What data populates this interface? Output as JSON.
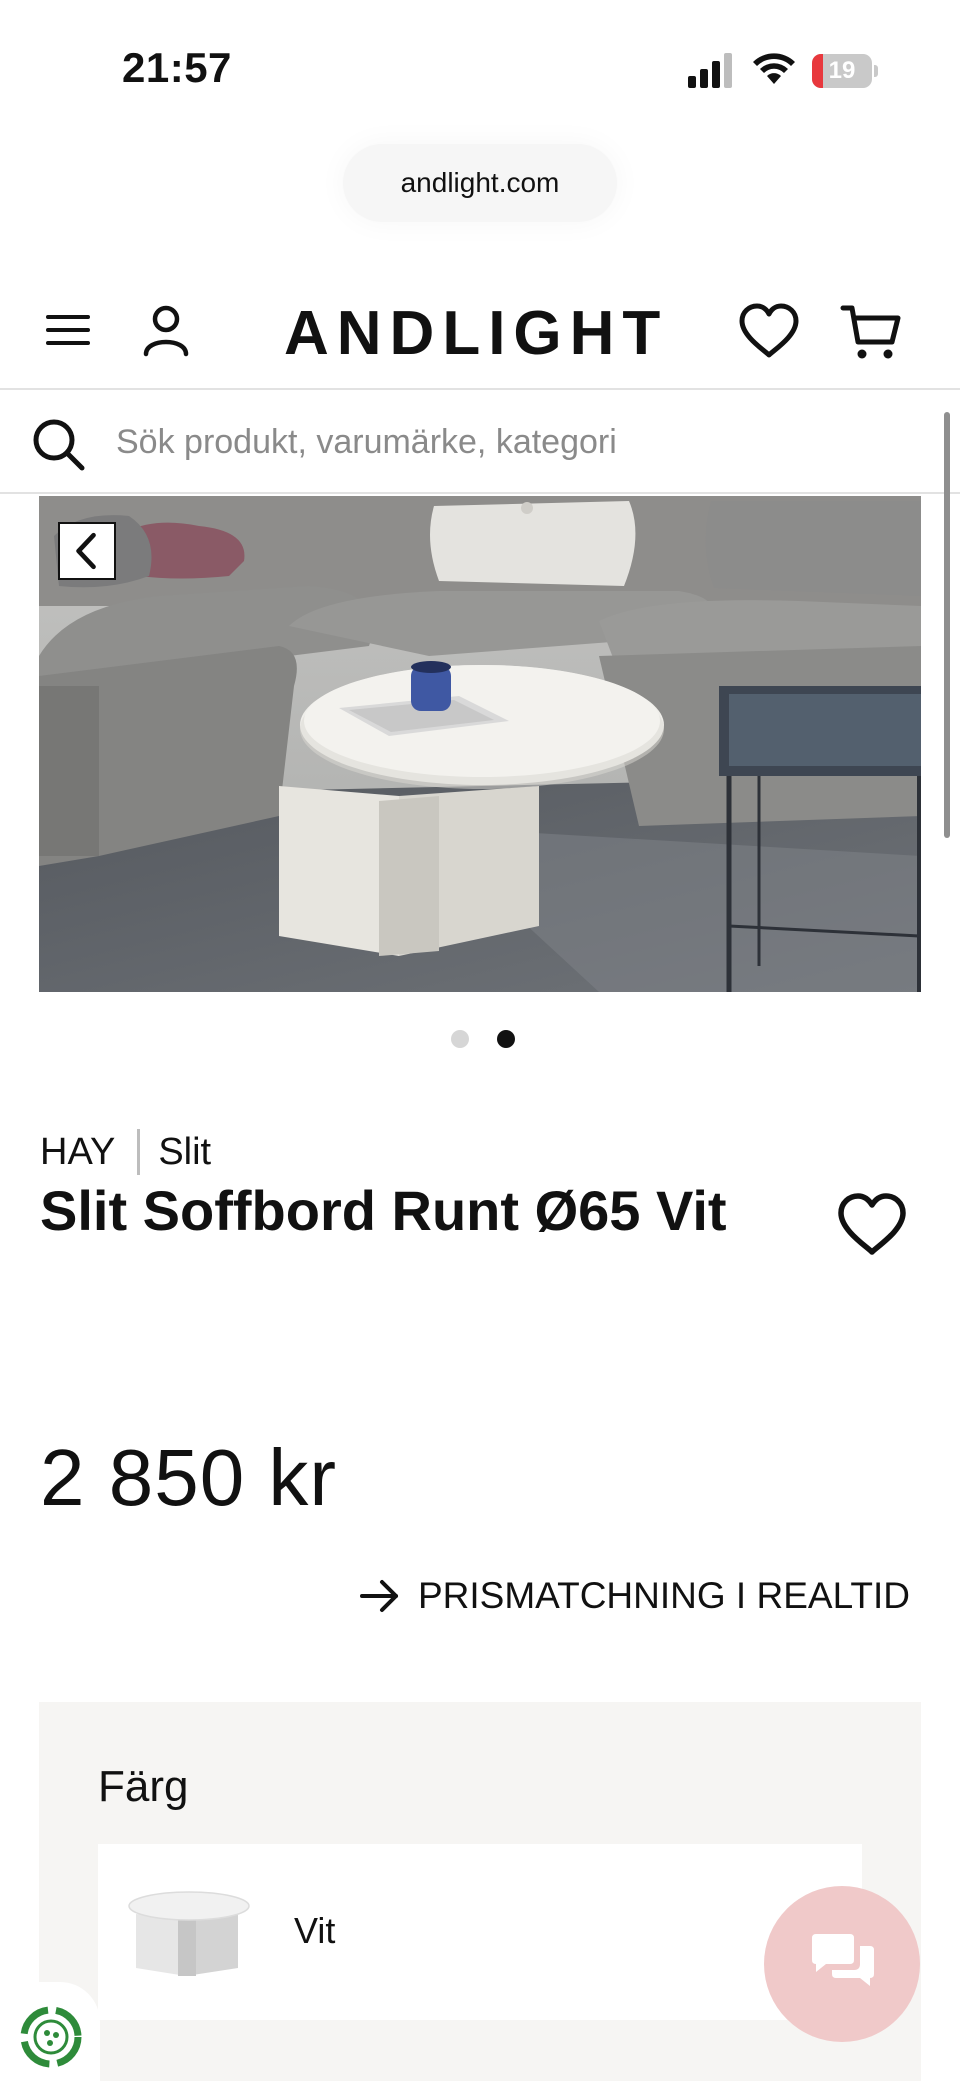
{
  "status_bar": {
    "time": "21:57",
    "battery_level": "19",
    "battery_fraction": 0.19,
    "battery_color": "#e8383d"
  },
  "browser": {
    "url": "andlight.com"
  },
  "header": {
    "logo": "ANDLIGHT",
    "icons": [
      "menu-icon",
      "account-icon",
      "wishlist-icon",
      "cart-icon"
    ]
  },
  "search": {
    "placeholder": "Sök produkt, varumärke, kategori"
  },
  "gallery": {
    "image_count": 2,
    "active_index": 1,
    "dot_active_color": "#111111",
    "dot_inactive_color": "#d6d6d6"
  },
  "product": {
    "brand": "HAY",
    "collection": "Slit",
    "title": "Slit Soffbord Runt Ø65 Vit",
    "price": "2 850 kr"
  },
  "price_match": {
    "label": "PRISMATCHNING I REALTID"
  },
  "variants": {
    "heading": "Färg",
    "options": [
      {
        "name": "Vit"
      }
    ]
  },
  "chat": {
    "color": "#f0c9c9"
  }
}
